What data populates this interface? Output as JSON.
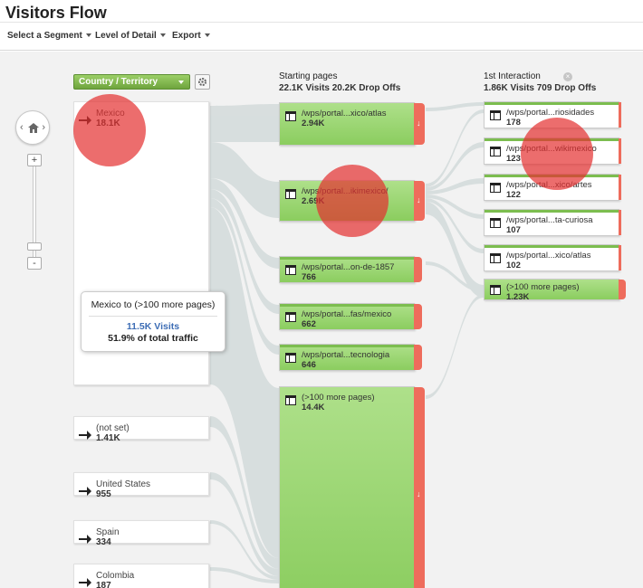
{
  "title": "Visitors Flow",
  "toolbar": {
    "segment": "Select a Segment",
    "detail": "Level of Detail",
    "export": "Export"
  },
  "zoom": {
    "plus": "+",
    "minus": "-"
  },
  "dimension": {
    "selected": "Country / Territory"
  },
  "columns": {
    "starting": {
      "title": "Starting pages",
      "stats": "22.1K Visits 20.2K Drop Offs"
    },
    "interaction": {
      "title": "1st Interaction",
      "stats": "1.86K Visits 709 Drop Offs"
    }
  },
  "countries": [
    {
      "name": "Mexico",
      "value": "18.1K"
    },
    {
      "name": "(not set)",
      "value": "1.41K"
    },
    {
      "name": "United States",
      "value": "955"
    },
    {
      "name": "Spain",
      "value": "334"
    },
    {
      "name": "Colombia",
      "value": "187"
    }
  ],
  "starting_pages": [
    {
      "name": "/wps/portal...xico/atlas",
      "value": "2.94K"
    },
    {
      "name": "/wps/portal...ikimexico/",
      "value": "2.69K"
    },
    {
      "name": "/wps/portal...on-de-1857",
      "value": "766"
    },
    {
      "name": "/wps/portal...fas/mexico",
      "value": "662"
    },
    {
      "name": "/wps/portal...tecnologia",
      "value": "646"
    },
    {
      "name": "(>100 more pages)",
      "value": "14.4K"
    }
  ],
  "interaction_pages": [
    {
      "name": "/wps/portal...riosidades",
      "value": "178"
    },
    {
      "name": "/wps/portal...wikimexico",
      "value": "123"
    },
    {
      "name": "/wps/portal...xico/artes",
      "value": "122"
    },
    {
      "name": "/wps/portal...ta-curiosa",
      "value": "107"
    },
    {
      "name": "/wps/portal...xico/atlas",
      "value": "102"
    },
    {
      "name": "(>100 more pages)",
      "value": "1.23K"
    }
  ],
  "tooltip": {
    "title": "Mexico to (>100 more pages)",
    "visits": "11.5K Visits",
    "share": "51.9% of total traffic"
  },
  "colors": {
    "node_green": "#8bcd5f",
    "dropoff_red": "#ee6c5c",
    "flow_gray": "#d3dbdb",
    "highlight": "#e42f2f"
  }
}
